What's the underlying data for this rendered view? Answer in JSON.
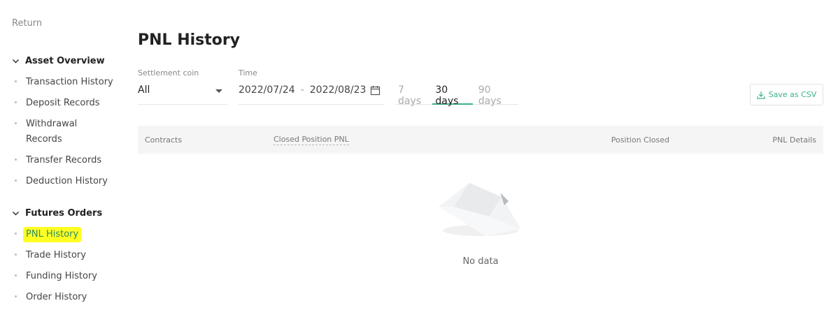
{
  "sidebar": {
    "return_label": "Return",
    "groups": [
      {
        "label": "Asset Overview",
        "items": [
          "Transaction History",
          "Deposit Records",
          "Withdrawal Records",
          "Transfer Records",
          "Deduction History"
        ]
      },
      {
        "label": "Futures Orders",
        "items": [
          "PNL History",
          "Trade History",
          "Funding History",
          "Order History"
        ]
      }
    ],
    "active_item": "PNL History"
  },
  "page": {
    "title": "PNL History"
  },
  "filters": {
    "settlement_label": "Settlement coin",
    "settlement_value": "All",
    "time_label": "Time",
    "date_start": "2022/07/24",
    "date_separator": "-",
    "date_end": "2022/08/23",
    "ranges": [
      "7 days",
      "30 days",
      "90 days"
    ],
    "active_range": "30 days"
  },
  "toolbar": {
    "save_csv_label": "Save as CSV"
  },
  "table": {
    "columns": [
      "Contracts",
      "Closed Position PNL",
      "Position Closed",
      "PNL Details"
    ],
    "empty_text": "No data"
  },
  "colors": {
    "accent": "#3ab384",
    "highlight": "#ffff22"
  }
}
